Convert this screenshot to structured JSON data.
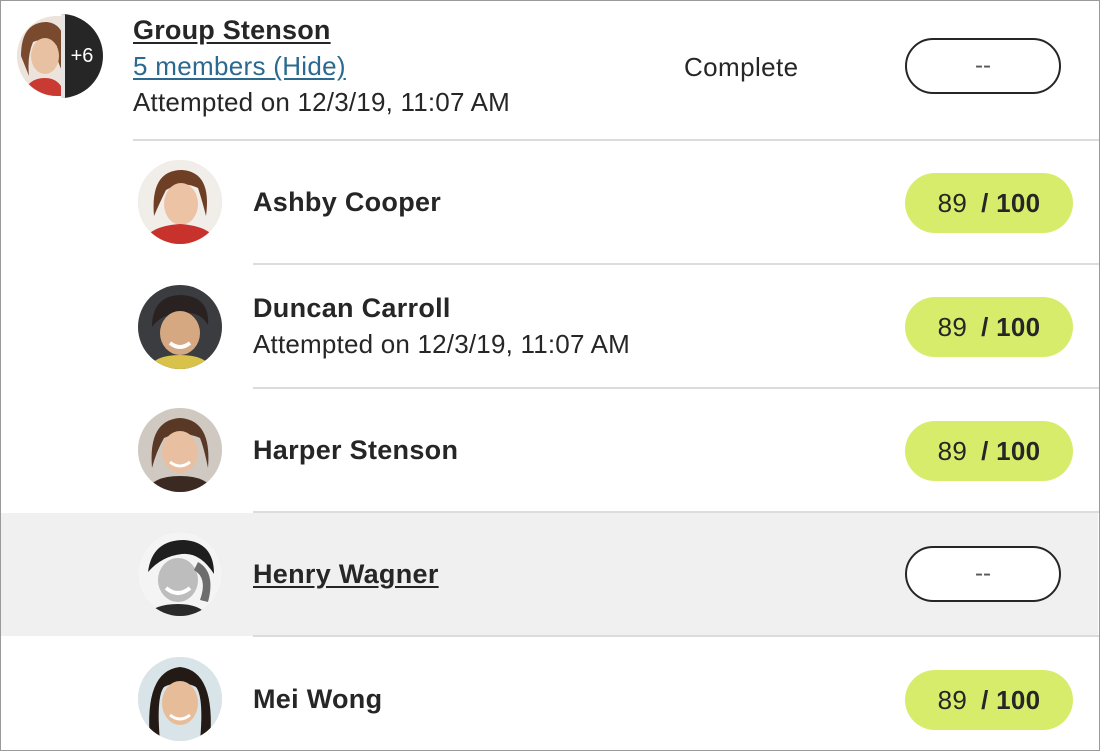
{
  "group": {
    "name": "Group Stenson",
    "members_link": "5 members (Hide)",
    "attempted": "Attempted on 12/3/19, 11:07 AM",
    "status": "Complete",
    "grade": "--",
    "extra_count": "+6"
  },
  "members": [
    {
      "name": "Ashby Cooper",
      "attempted": "",
      "score": "89",
      "total": "/ 100"
    },
    {
      "name": "Duncan Carroll",
      "attempted": "Attempted on 12/3/19, 11:07 AM",
      "score": "89",
      "total": "/ 100"
    },
    {
      "name": "Harper Stenson",
      "attempted": "",
      "score": "89",
      "total": "/ 100"
    },
    {
      "name": "Henry Wagner",
      "grade": "--"
    },
    {
      "name": "Mei Wong",
      "attempted": "",
      "score": "89",
      "total": "/ 100"
    }
  ],
  "colors": {
    "grade_pill": "#d8ec6c",
    "link": "#2b6a8e",
    "row_highlight": "#f0f0f0"
  }
}
